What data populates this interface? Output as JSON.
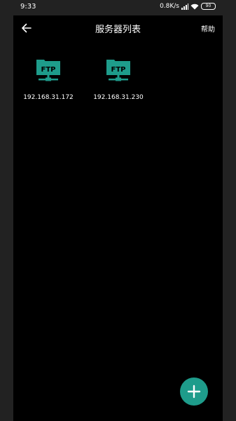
{
  "status_bar": {
    "time": "9:33",
    "network_speed": "0.8K/s",
    "battery": "90",
    "icons": [
      "signal-icon",
      "wifi-icon",
      "battery-icon"
    ]
  },
  "app_bar": {
    "title": "服务器列表",
    "help_label": "帮助",
    "back_icon": "arrow-left-icon"
  },
  "servers": [
    {
      "icon": "ftp-server-icon",
      "icon_text": "FTP",
      "address": "192.168.31.172"
    },
    {
      "icon": "ftp-server-icon",
      "icon_text": "FTP",
      "address": "192.168.31.230"
    }
  ],
  "fab": {
    "icon": "plus-icon"
  },
  "colors": {
    "background": "#000000",
    "bezel": "#222222",
    "accent": "#1e9c8b",
    "text": "#ffffff"
  }
}
